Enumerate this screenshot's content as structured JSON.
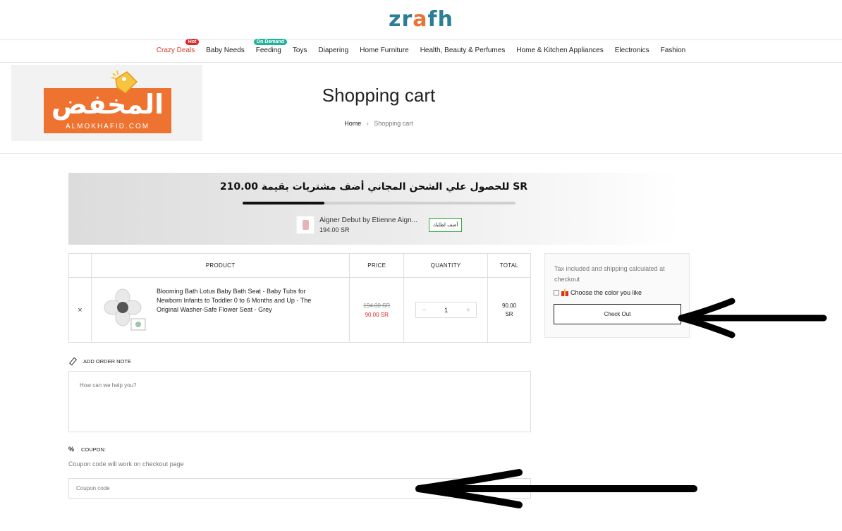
{
  "header": {
    "logo": "zrafh",
    "nav": [
      {
        "label": "Crazy Deals",
        "badge": "Hot"
      },
      {
        "label": "Baby Needs"
      },
      {
        "label": "Feeding",
        "badge": "On Demand"
      },
      {
        "label": "Toys"
      },
      {
        "label": "Diapering"
      },
      {
        "label": "Home Furniture"
      },
      {
        "label": "Health, Beauty & Perfumes"
      },
      {
        "label": "Home & Kitchen Appliances"
      },
      {
        "label": "Electronics"
      },
      {
        "label": "Fashion"
      }
    ]
  },
  "banner": {
    "brand_arabic": "المخفض",
    "brand_latin": "ALMOKHAFID.COM",
    "title": "Shopping cart",
    "breadcrumb": {
      "home": "Home",
      "current": "Shopping cart"
    }
  },
  "shipping": {
    "message": "SR للحصول علي الشحن المجاني أضف مشتريات بقيمة 210.00",
    "progress_fraction": 0.3,
    "upsell": {
      "name": "Aigner Debut by Etienne Aign...",
      "price": "194.00 SR",
      "add_label": "أضف لطلبك"
    }
  },
  "cart": {
    "headers": {
      "product": "Product",
      "price": "Price",
      "quantity": "Quantity",
      "total": "Total"
    },
    "items": [
      {
        "remove": "×",
        "name": "Blooming Bath Lotus Baby Bath Seat - Baby Tubs for Newborn Infants to Toddler 0 to 6 Months and Up - The Original Washer-Safe Flower Seat - Grey",
        "old_price": "194.00 SR",
        "price": "90.00 SR",
        "quantity": "1",
        "minus": "−",
        "plus": "+",
        "total_value": "90.00",
        "total_currency": "SR"
      }
    ]
  },
  "summary": {
    "tax_note": "Tax included and shipping calculated at checkout",
    "color_option": "Choose the color you like",
    "checkout_label": "Check Out"
  },
  "order_note": {
    "heading": "ADD ORDER NOTE",
    "placeholder": "How can we help you?"
  },
  "coupon": {
    "icon": "%",
    "heading": "COUPON:",
    "hint": "Coupon code will work on checkout page",
    "placeholder": "Coupon code"
  },
  "icons": {
    "remove": "close-icon",
    "note": "pencil-icon",
    "coupon": "percent-icon",
    "gift": "gift-icon",
    "annotation": "arrow-left-icon"
  },
  "colors": {
    "brand_teal": "#2a7e95",
    "brand_orange": "#ef7330",
    "sale_red": "#e0252a",
    "badge_green": "#1fb39b",
    "upsell_border": "#2eaa3c"
  }
}
